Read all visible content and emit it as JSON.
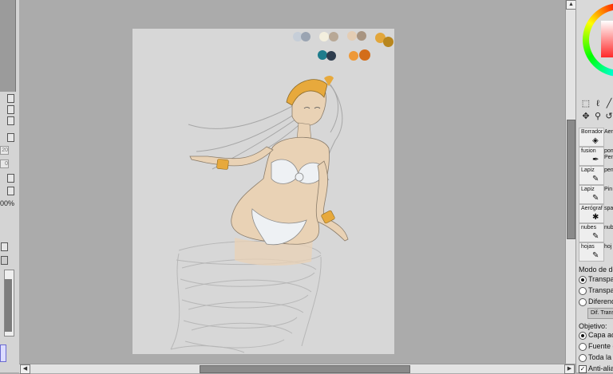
{
  "left_panel": {
    "field_values": [
      "20",
      "0"
    ],
    "zoom_text": "00%"
  },
  "palette": {
    "row1": [
      "#c6ced8",
      "#9aa4b2",
      "#f3efde",
      "#b8a896",
      "#e4cdb4",
      "#a89480",
      "#e2a63b",
      "#b8861e"
    ],
    "row2": [
      "#1e7c8c",
      "#2e3d4e",
      "#ee9938",
      "#d36d1a"
    ]
  },
  "brushes": [
    {
      "name": "Borrador",
      "pair": "Aer"
    },
    {
      "name": "fusion",
      "pair": "pon Pen"
    },
    {
      "name": "Lapiz",
      "pair": "pen"
    },
    {
      "name": "Lapiz",
      "pair": "Pin"
    },
    {
      "name": "Aerógraf",
      "pair": "spa"
    },
    {
      "name": "nubes",
      "pair": "nub"
    },
    {
      "name": "hojas",
      "pair": "hoj"
    }
  ],
  "options": {
    "mode_label": "Modo de det",
    "mode_options": [
      "Transpar",
      "Transpar",
      "Diferencia"
    ],
    "mode_selected": 0,
    "dif_button": "Dif. Trans",
    "objective_label": "Objetivo:",
    "objective_options": [
      "Capa act",
      "Fuente d",
      "Toda la i"
    ],
    "objective_selected": 0,
    "antialias_label": "Anti-alias"
  },
  "icons": {
    "scroll_left": "arrow-left-icon",
    "scroll_right": "arrow-right-icon",
    "scroll_up": "arrow-up-icon",
    "color_wheel": "color-wheel-icon",
    "select_rect": "rect-select-icon",
    "lasso": "lasso-icon",
    "magic_wand": "magic-wand-icon",
    "move": "move-icon",
    "zoom": "zoom-icon",
    "rotate": "rotate-icon"
  }
}
